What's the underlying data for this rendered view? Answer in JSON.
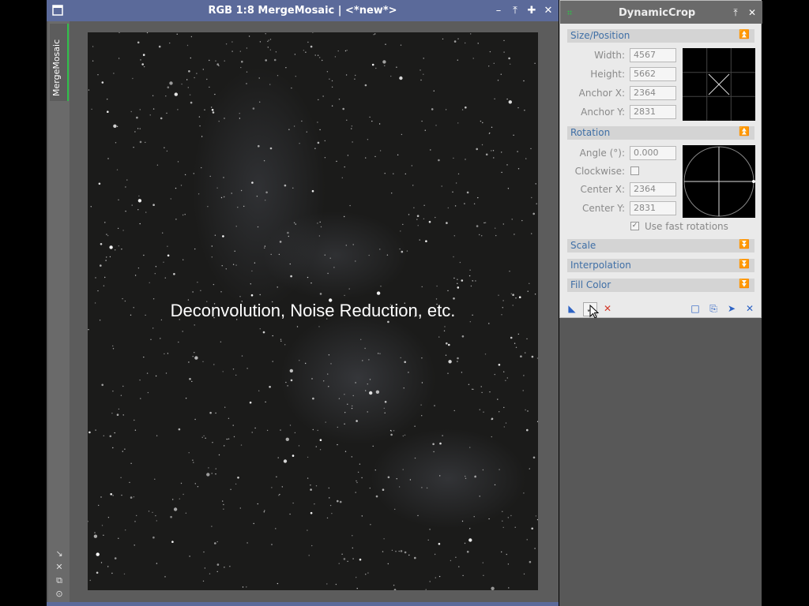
{
  "image_window": {
    "title": "RGB 1:8 MergeMosaic | <*new*>",
    "view_tab_label": "MergeMosaic",
    "overlay_text": "Deconvolution, Noise Reduction, etc.",
    "controls": {
      "minimize": "–",
      "shade": "⤒",
      "maximize": "✚",
      "close": "✕"
    }
  },
  "panel": {
    "title": "DynamicCrop",
    "sections": {
      "size_position": {
        "label": "Size/Position",
        "width_label": "Width:",
        "width_value": "4567",
        "height_label": "Height:",
        "height_value": "5662",
        "anchor_x_label": "Anchor X:",
        "anchor_x_value": "2364",
        "anchor_y_label": "Anchor Y:",
        "anchor_y_value": "2831"
      },
      "rotation": {
        "label": "Rotation",
        "angle_label": "Angle (°):",
        "angle_value": "0.000",
        "clockwise_label": "Clockwise:",
        "center_x_label": "Center X:",
        "center_x_value": "2364",
        "center_y_label": "Center Y:",
        "center_y_value": "2831",
        "fast_rotations_label": "Use fast rotations"
      },
      "scale": {
        "label": "Scale"
      },
      "interpolation": {
        "label": "Interpolation"
      },
      "fill_color": {
        "label": "Fill Color"
      }
    }
  },
  "colors": {
    "title_bar": "#5b6a9a",
    "accent_green": "#2fbf4a",
    "section_text": "#3f6fa6"
  }
}
